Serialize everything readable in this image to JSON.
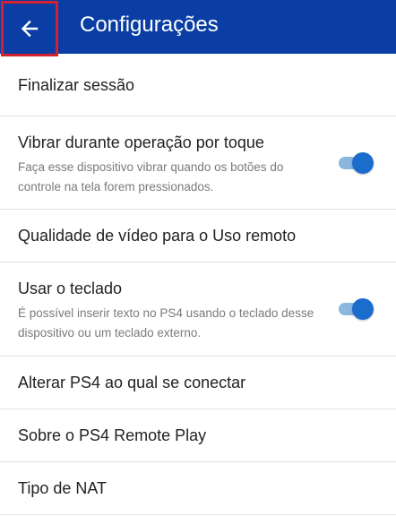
{
  "header": {
    "title": "Configurações",
    "back_icon": "arrow-left-icon",
    "background_color": "#0a3ea5",
    "highlight_color": "#d3212d"
  },
  "settings": {
    "logout": {
      "title": "Finalizar sessão"
    },
    "vibrate": {
      "title": "Vibrar durante operação por toque",
      "description": "Faça esse dispositivo vibrar quando os botões do controle na tela forem pressionados.",
      "enabled": true
    },
    "video_quality": {
      "title": "Qualidade de vídeo para o Uso remoto"
    },
    "keyboard": {
      "title": "Usar o teclado",
      "description": "É possível inserir texto no PS4 usando o teclado desse dispositivo ou um teclado externo.",
      "enabled": true
    },
    "change_ps4": {
      "title": "Alterar PS4 ao qual se conectar"
    },
    "about": {
      "title": "Sobre o PS4 Remote Play"
    },
    "nat_type": {
      "title": "Tipo de NAT"
    }
  },
  "colors": {
    "toggle_on_thumb": "#1b6dcd",
    "toggle_on_track": "#8bb6e0"
  }
}
